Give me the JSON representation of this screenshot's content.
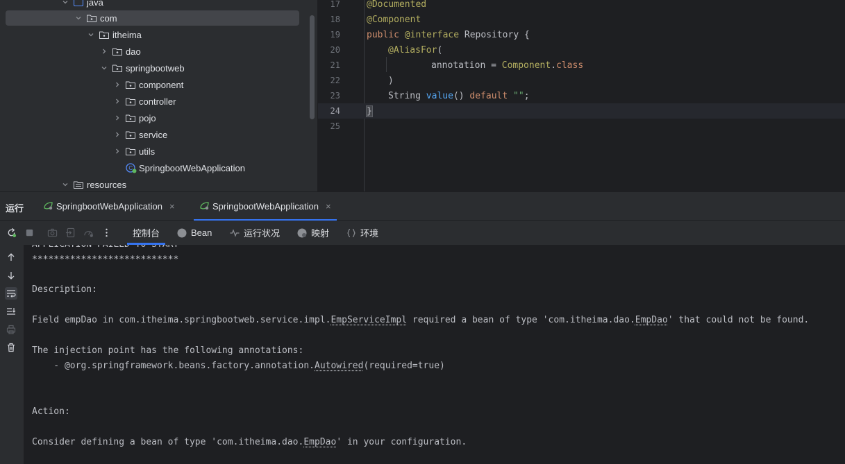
{
  "project_tree": {
    "items": [
      {
        "label": "java",
        "expanded": true
      },
      {
        "label": "com",
        "expanded": true
      },
      {
        "label": "itheima",
        "expanded": true
      },
      {
        "label": "dao",
        "expanded": false
      },
      {
        "label": "springbootweb",
        "expanded": true
      },
      {
        "label": "component",
        "expanded": false
      },
      {
        "label": "controller",
        "expanded": false
      },
      {
        "label": "pojo",
        "expanded": false
      },
      {
        "label": "service",
        "expanded": false
      },
      {
        "label": "utils",
        "expanded": false
      },
      {
        "label": "SpringbootWebApplication",
        "type": "spring-class"
      },
      {
        "label": "resources",
        "expanded": true
      }
    ]
  },
  "editor": {
    "line_numbers": [
      "17",
      "18",
      "19",
      "20",
      "21",
      "22",
      "23",
      "24",
      "25"
    ],
    "current_line": "24",
    "code": {
      "l17": "@Documented",
      "l18": "@Component",
      "l19_kw1": "public ",
      "l19_kw2": "@interface ",
      "l19_name": "Repository ",
      "l19_brace": "{",
      "l20_ann": "@AliasFor",
      "l20_paren": "(",
      "l21_name": "annotation = ",
      "l21_ref": "Component",
      "l21_dot": ".",
      "l21_kw": "class",
      "l22": ")",
      "l23_type": "String ",
      "l23_fn": "value",
      "l23_paren": "() ",
      "l23_kw": "default ",
      "l23_str": "\"\"",
      "l23_semi": ";",
      "l24": "}"
    }
  },
  "run_panel": {
    "title": "运行",
    "tabs": [
      {
        "label": "SpringbootWebApplication",
        "close": "×",
        "active": false
      },
      {
        "label": "SpringbootWebApplication",
        "close": "×",
        "active": true
      }
    ],
    "console_tabs": [
      {
        "label": "控制台",
        "icon": "none",
        "active": true
      },
      {
        "label": "Bean",
        "icon": "bean-icon"
      },
      {
        "label": "运行状况",
        "icon": "health-icon"
      },
      {
        "label": "映射",
        "icon": "mapping-icon"
      },
      {
        "label": "环境",
        "icon": "env-icon"
      }
    ]
  },
  "console": {
    "l0": "APPLICATION FAILED TO START",
    "l1": "***************************",
    "l3": "Description:",
    "l5_a": "Field empDao in com.itheima.springbootweb.service.impl.",
    "l5_b": "EmpServiceImpl",
    "l5_c": " required a bean of type 'com.itheima.dao.",
    "l5_d": "EmpDao",
    "l5_e": "' that could not be found.",
    "l7": "The injection point has the following annotations:",
    "l8_a": "    - @org.springframework.beans.factory.annotation.",
    "l8_b": "Autowired",
    "l8_c": "(required=true)",
    "l11": "Action:",
    "l13_a": "Consider defining a bean of type 'com.itheima.dao.",
    "l13_b": "EmpDao",
    "l13_c": "' in your configuration."
  },
  "colors": {
    "accent": "#3574f0",
    "keyword": "#cf8e6d",
    "annotation": "#b3ae60",
    "method": "#56a8f5",
    "string": "#6aab73",
    "spring_green": "#5fb85f"
  }
}
